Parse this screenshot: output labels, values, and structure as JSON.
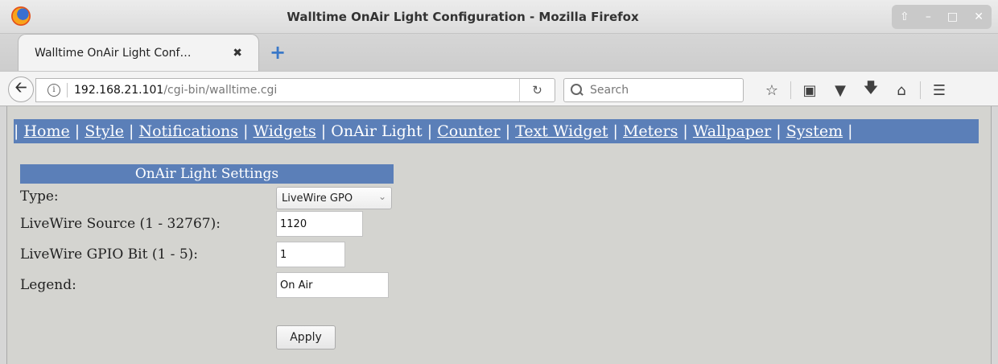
{
  "window": {
    "title": "Walltime OnAir Light Configuration - Mozilla Firefox",
    "controls": [
      "⇧",
      "–",
      "□",
      "✕"
    ]
  },
  "tab": {
    "title": "Walltime OnAir Light Conf…",
    "close": "✖",
    "new_tab": "+"
  },
  "nav": {
    "back": "🡠",
    "info": "i",
    "url_host": "192.168.21.101",
    "url_path": "/cgi-bin/walltime.cgi",
    "reload": "↻",
    "search_placeholder": "Search",
    "icons": [
      "star-icon",
      "reading-list-icon",
      "pocket-icon",
      "download-icon",
      "home-icon",
      "menu-icon"
    ]
  },
  "menu": {
    "items": [
      "Home",
      "Style",
      "Notifications",
      "Widgets",
      "OnAir Light",
      "Counter",
      "Text Widget",
      "Meters",
      "Wallpaper",
      "System"
    ],
    "active": "OnAir Light"
  },
  "settings": {
    "header": "OnAir Light Settings",
    "type_label": "Type:",
    "type_value": "LiveWire GPO",
    "source_label": "LiveWire Source (1 - 32767):",
    "source_value": "1120",
    "gpio_label": "LiveWire GPIO Bit (1 - 5):",
    "gpio_value": "1",
    "legend_label": "Legend:",
    "legend_value": "On Air",
    "apply_label": "Apply"
  }
}
